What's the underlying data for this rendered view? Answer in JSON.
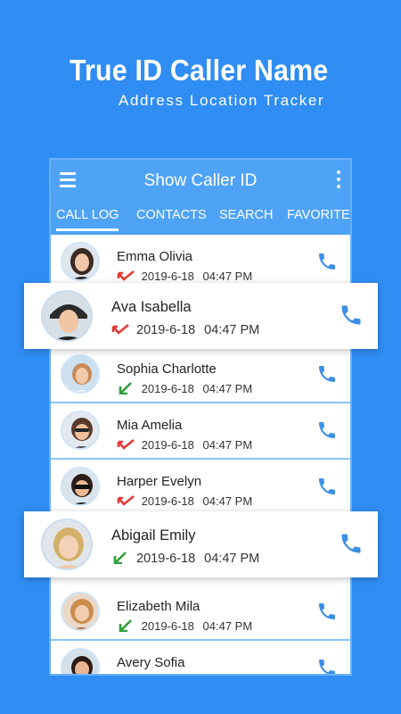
{
  "promo": {
    "title": "True ID Caller Name",
    "subtitle": "Address Location Tracker"
  },
  "appbar": {
    "title": "Show Caller ID",
    "menu_icon": "hamburger-menu-icon",
    "more_icon": "more-vert-icon",
    "color": "#4fa3f7"
  },
  "tabs": [
    {
      "label": "CALL LOG",
      "active": true
    },
    {
      "label": "CONTACTS",
      "active": false
    },
    {
      "label": "SEARCH",
      "active": false
    },
    {
      "label": "FAVORITE",
      "active": false
    }
  ],
  "calls": [
    {
      "name": "Emma Olivia",
      "date": "2019-6-18",
      "time": "04:47 PM",
      "type": "missed"
    },
    {
      "name": "Ava Isabella",
      "date": "2019-6-18",
      "time": "04:47 PM",
      "type": "missed"
    },
    {
      "name": "Sophia Charlotte",
      "date": "2019-6-18",
      "time": "04:47 PM",
      "type": "incoming"
    },
    {
      "name": "Mia Amelia",
      "date": "2019-6-18",
      "time": "04:47 PM",
      "type": "missed"
    },
    {
      "name": "Harper Evelyn",
      "date": "2019-6-18",
      "time": "04:47 PM",
      "type": "missed"
    },
    {
      "name": "Abigail Emily",
      "date": "2019-6-18",
      "time": "04:47 PM",
      "type": "incoming"
    },
    {
      "name": "Elizabeth Mila",
      "date": "2019-6-18",
      "time": "04:47 PM",
      "type": "incoming"
    },
    {
      "name": "Avery Sofia",
      "date": "",
      "time": "",
      "type": ""
    }
  ],
  "colors": {
    "background": "#2f8df3",
    "missed": "#e53935",
    "incoming": "#2e9e3a",
    "call_icon": "#3b8fe6"
  }
}
